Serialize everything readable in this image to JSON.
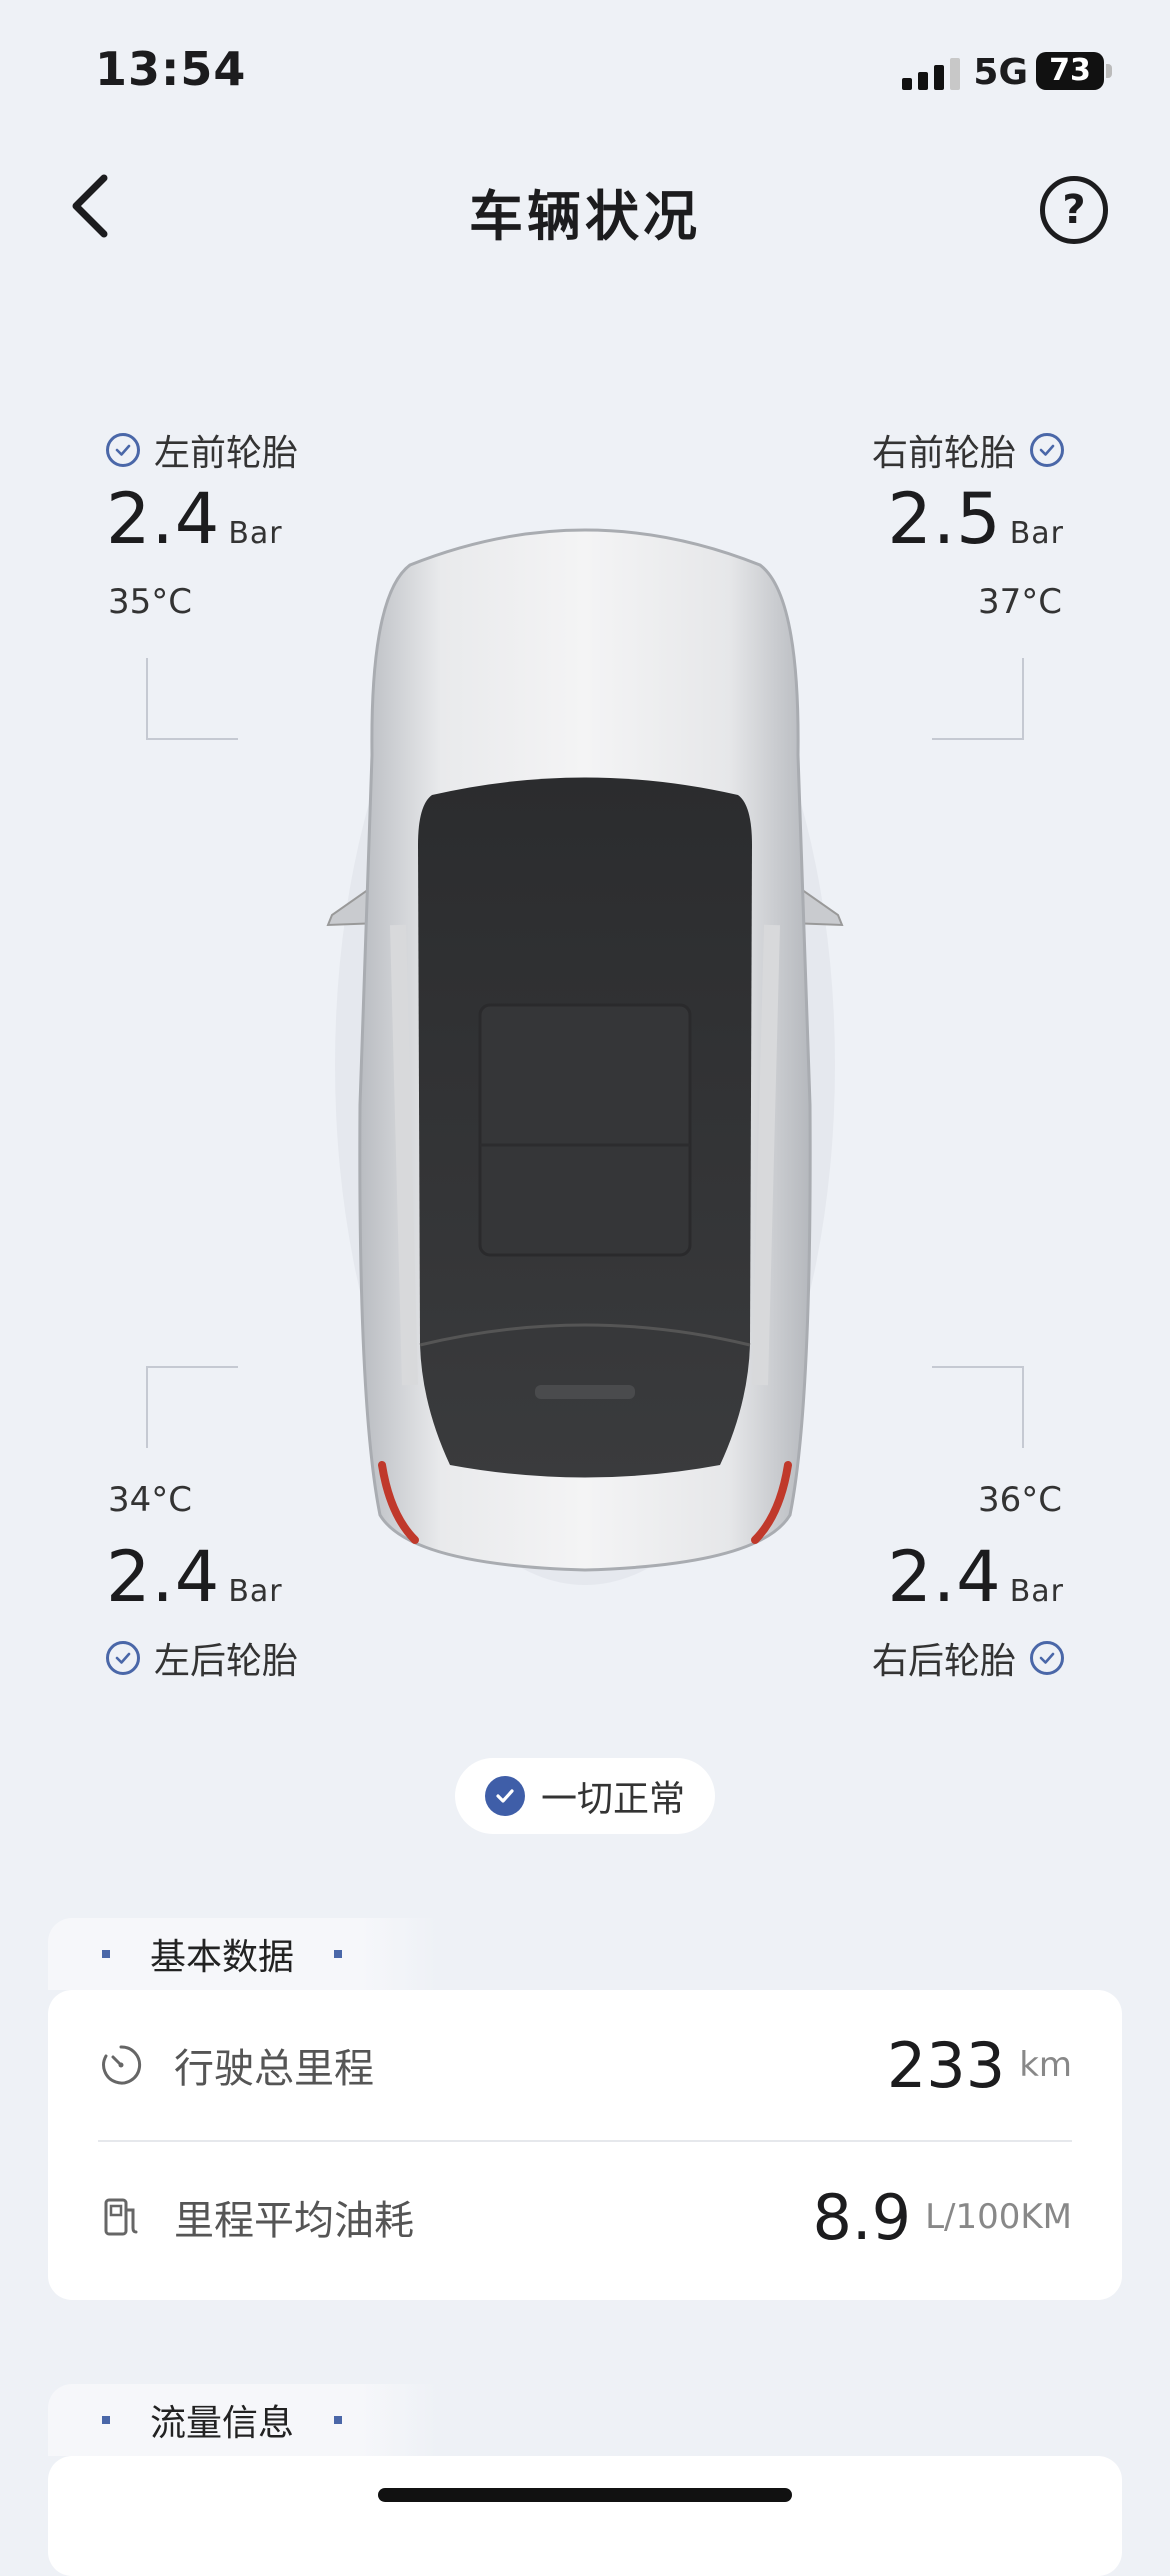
{
  "status_bar": {
    "time": "13:54",
    "network": "5G",
    "battery": "73"
  },
  "nav": {
    "title": "车辆状况"
  },
  "tires": {
    "front_left": {
      "label": "左前轮胎",
      "pressure": "2.4",
      "unit": "Bar",
      "temp": "35°C"
    },
    "front_right": {
      "label": "右前轮胎",
      "pressure": "2.5",
      "unit": "Bar",
      "temp": "37°C"
    },
    "rear_left": {
      "label": "左后轮胎",
      "pressure": "2.4",
      "unit": "Bar",
      "temp": "34°C"
    },
    "rear_right": {
      "label": "右后轮胎",
      "pressure": "2.4",
      "unit": "Bar",
      "temp": "36°C"
    }
  },
  "status": {
    "text": "一切正常"
  },
  "basic": {
    "tab": "基本数据",
    "rows": [
      {
        "label": "行驶总里程",
        "value": "233",
        "unit": "km",
        "icon": "speedometer-icon"
      },
      {
        "label": "里程平均油耗",
        "value": "8.9",
        "unit": "L/100KM",
        "icon": "fuel-pump-icon"
      }
    ]
  },
  "traffic": {
    "tab": "流量信息"
  },
  "colors": {
    "accent": "#3f5ea8",
    "background": "#eef1f6"
  }
}
